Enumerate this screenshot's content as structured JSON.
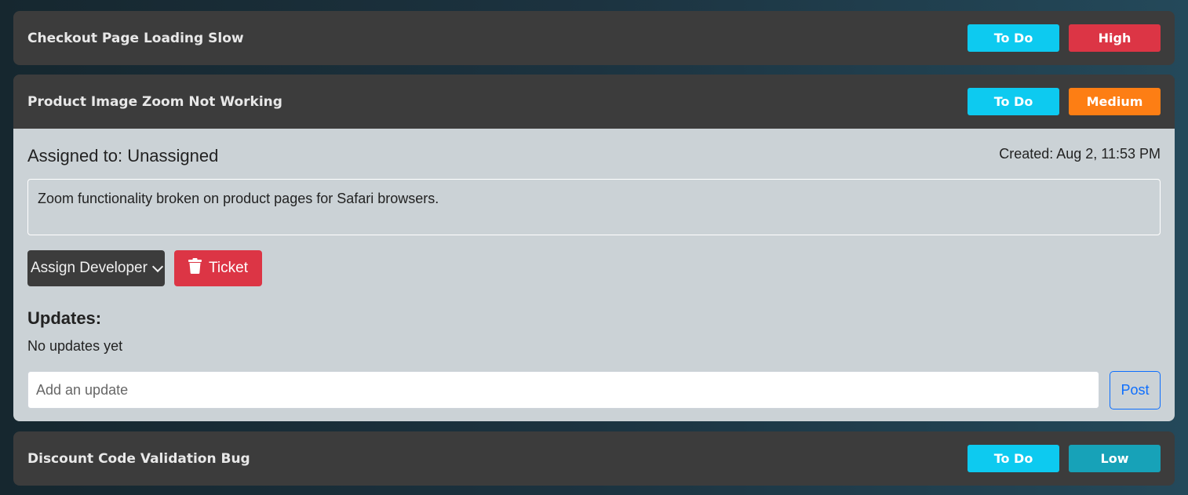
{
  "tickets": [
    {
      "title": "Checkout Page Loading Slow",
      "status": "To Do",
      "priority": "High",
      "priority_color": "#dc3545",
      "expanded": false
    },
    {
      "title": "Product Image Zoom Not Working",
      "status": "To Do",
      "priority": "Medium",
      "priority_color": "#fd7e14",
      "expanded": true,
      "assigned": "Assigned to: Unassigned",
      "created": "Created: Aug 2, 11:53 PM",
      "description": "Zoom functionality broken on product pages for Safari browsers.",
      "assign_label": "Assign Developer",
      "delete_label": "Ticket",
      "updates_heading": "Updates:",
      "no_updates": "No updates yet",
      "update_placeholder": "Add an update",
      "post_label": "Post"
    },
    {
      "title": "Discount Code Validation Bug",
      "status": "To Do",
      "priority": "Low",
      "priority_color": "#17a2b8",
      "expanded": false
    }
  ],
  "icons": {
    "delete": "trash-icon",
    "dropdown": "chevron-down-icon"
  },
  "colors": {
    "status_badge": "#0dcaf0",
    "card_header": "#3c3c3c",
    "card_body": "#cbd2d6",
    "post_button": "#0d6efd"
  }
}
